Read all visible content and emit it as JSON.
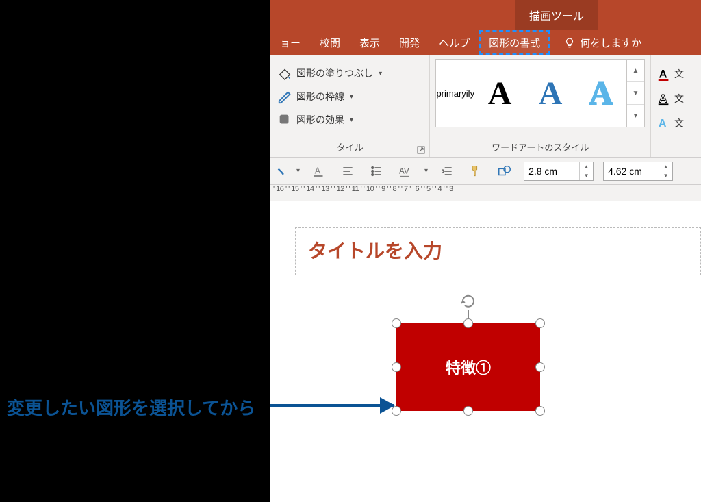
{
  "titlebar": {
    "context_tab": "描画ツール"
  },
  "tabs": {
    "slideshow_tail": "ョー",
    "review": "校閲",
    "view": "表示",
    "developer": "開発",
    "help": "ヘルプ",
    "format": "図形の書式",
    "tellme": "何をしますか"
  },
  "ribbon": {
    "shape_styles": {
      "label_tail": "タイル",
      "fill": "図形の塗りつぶし",
      "outline": "図形の枠線",
      "effects": "図形の効果"
    },
    "wordart": {
      "group_label": "ワードアートのスタイル",
      "sample1": "A",
      "sample2": "A",
      "sample3": "A"
    },
    "text_options": {
      "fill_tail": "文",
      "outline_tail": "文",
      "effects_tail": "文"
    }
  },
  "qat": {
    "height": "2.8 cm",
    "width": "4.62 cm"
  },
  "ruler": "' 16 ' ' 15 ' ' 14 ' ' 13 ' ' 12 ' ' 11 ' ' 10 ' ' 9 ' ' 8 ' ' 7 ' ' 6 ' ' 5 ' ' 4 ' ' 3",
  "slide": {
    "title_placeholder": "タイトルを入力",
    "shape_text": "特徴①"
  },
  "annotation": {
    "callout": "変更したい図形を選択してから"
  }
}
